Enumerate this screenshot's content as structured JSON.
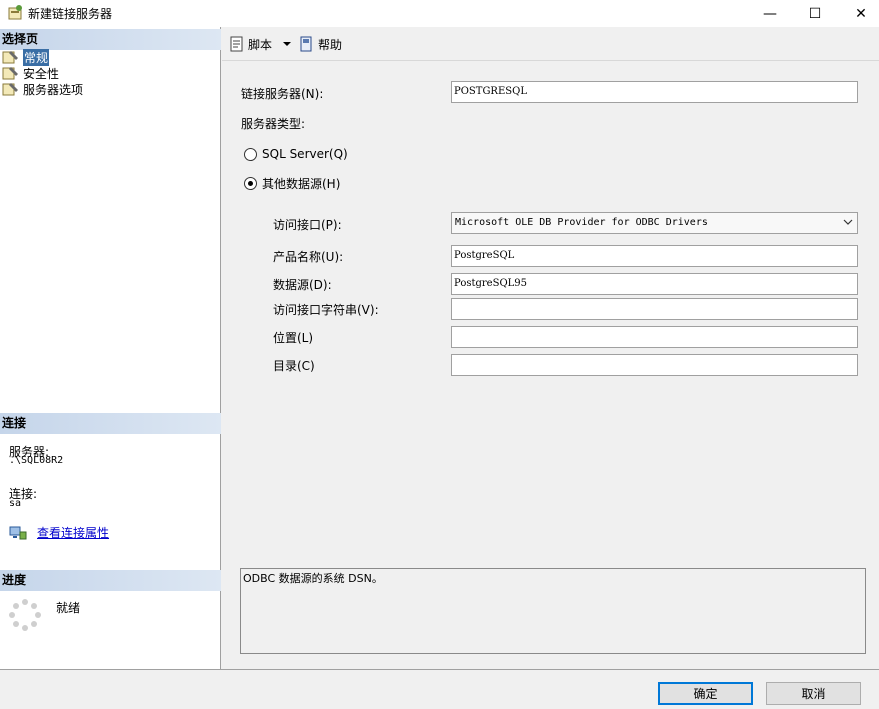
{
  "window": {
    "title": "新建链接服务器",
    "minimize_glyph": "—",
    "maximize_glyph": "☐",
    "close_glyph": "✕"
  },
  "left_pane": {
    "select_page_header": "选择页",
    "nav_items": [
      {
        "label": "常规",
        "selected": true,
        "icon": "page-wrench-icon"
      },
      {
        "label": "安全性",
        "selected": false,
        "icon": "page-wrench-icon"
      },
      {
        "label": "服务器选项",
        "selected": false,
        "icon": "page-wrench-icon"
      }
    ],
    "connection_header": "连接",
    "server_label": "服务器:",
    "server_value": ".\\SQL08R2",
    "connection_label": "连接:",
    "connection_value": "sa",
    "view_connection_link": "查看连接属性",
    "progress_header": "进度",
    "progress_status": "就绪"
  },
  "toolbar": {
    "script_label": "脚本",
    "help_label": "帮助"
  },
  "form": {
    "linked_server_label": "链接服务器(N):",
    "linked_server_value": "POSTGRESQL",
    "server_type_label": "服务器类型:",
    "radio_sql_server": "SQL Server(Q)",
    "radio_other": "其他数据源(H)",
    "selected_server_type": "other",
    "provider_label": "访问接口(P):",
    "provider_value": "Microsoft OLE DB Provider for ODBC Drivers",
    "product_name_label": "产品名称(U):",
    "product_name_value": "PostgreSQL",
    "data_source_label": "数据源(D):",
    "data_source_value": "PostgreSQL95",
    "provider_string_label": "访问接口字符串(V):",
    "provider_string_value": "",
    "location_label": "位置(L)",
    "location_value": "",
    "catalog_label": "目录(C)",
    "catalog_value": "",
    "description": "ODBC 数据源的系统 DSN。"
  },
  "buttons": {
    "ok": "确定",
    "cancel": "取消"
  },
  "colors": {
    "selection": "#3a6ea5",
    "section_header": "#c5d5ea",
    "primary_border": "#0078d7",
    "link": "#0000cc"
  }
}
